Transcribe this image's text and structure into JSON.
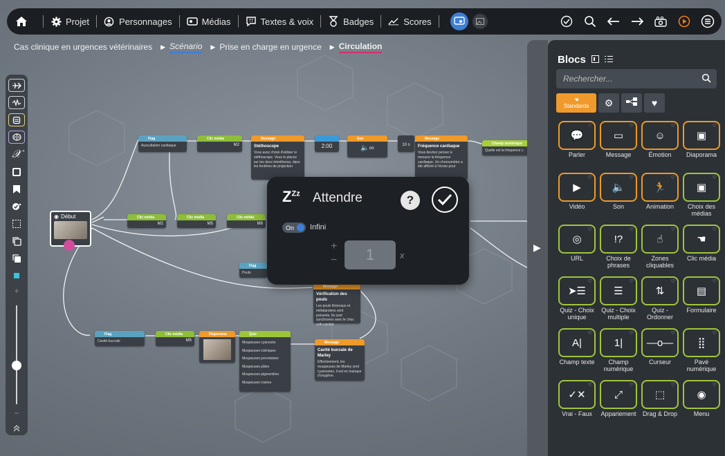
{
  "topbar": {
    "items": [
      {
        "label": "Projet",
        "icon": "gear-icon"
      },
      {
        "label": "Personnages",
        "icon": "character-icon"
      },
      {
        "label": "Médias",
        "icon": "media-icon"
      },
      {
        "label": "Textes & voix",
        "icon": "text-voice-icon"
      },
      {
        "label": "Badges",
        "icon": "badge-icon"
      },
      {
        "label": "Scores",
        "icon": "scores-icon"
      }
    ]
  },
  "breadcrumb": {
    "project": "Cas clinique en urgences vétérinaires",
    "scenario": "Scénario",
    "module": "Prise en charge en urgence",
    "current": "Circulation"
  },
  "nodes": {
    "flag1": {
      "type": "Flag",
      "text": "Auscultation cardiaque"
    },
    "clic1": {
      "type": "Clic média",
      "value": "M2"
    },
    "msg1": {
      "type": "Message",
      "title": "Stéthoscope",
      "text": "Vous avez choisi d'utiliser le stéthoscope. Vous le placez sur les deux hémithorax, dans les fenêtres de projection"
    },
    "timer1": {
      "value": "2:00"
    },
    "son1": {
      "type": "Son"
    },
    "timer2": {
      "value": "10 s"
    },
    "msg2": {
      "type": "Message",
      "title": "Fréquence cardiaque",
      "text": "Vous devriez penser à mesurer la fréquence cardiaque. Un chronomètre a été affiché à l'écran pour"
    },
    "champ1": {
      "type": "Champ numérique",
      "text": "Quelle est la fréquence c."
    },
    "debut": {
      "label": "Début"
    },
    "clic2": {
      "type": "Clic média",
      "value": "M2"
    },
    "clic3": {
      "type": "Clic média",
      "value": "M5"
    },
    "clic4": {
      "type": "Clic média",
      "value": "M6"
    },
    "flag2": {
      "type": "Flag",
      "text": "Pouls"
    },
    "msg3": {
      "type": "Message",
      "title": "Vérification des pouls",
      "text": "Les pouls fémoraux et métatarsiens sont présents. Ils sont synchrones avec le choc orth-cardial."
    },
    "flag3": {
      "type": "Flag",
      "text": "Cavité buccale"
    },
    "clic5": {
      "type": "Clic média",
      "value": "M5"
    },
    "diapo": {
      "type": "Diaporama"
    },
    "quiz": {
      "type": "Quiz",
      "options": [
        "Muqueuses cyanosés",
        "Muqueuses ictériques",
        "Muqueuses porcelaines",
        "Muqueuses pâles",
        "Muqueuses pigmentées",
        "Muqueuses rosées"
      ]
    },
    "msg4": {
      "type": "Message",
      "title": "Cavité buccale de Marley",
      "text": "Effectivement, les muqueuses de Marley sont cyanosées, il est en manque d'oxygène."
    }
  },
  "modal": {
    "title": "Attendre",
    "toggle_state": "On",
    "toggle_label": "Infini",
    "value": "1",
    "multiplier": "x"
  },
  "panel": {
    "title": "Blocs",
    "search_placeholder": "Rechercher...",
    "active_tab": "Standards",
    "blocks": [
      {
        "label": "Parler",
        "icon": "speech-bubble-icon",
        "color": "orange",
        "fav": true
      },
      {
        "label": "Message",
        "icon": "message-icon",
        "color": "orange"
      },
      {
        "label": "Émotion",
        "icon": "emotion-icon",
        "color": "orange"
      },
      {
        "label": "Diaporama",
        "icon": "slideshow-icon",
        "color": "orange"
      },
      {
        "label": "Vidéo",
        "icon": "video-icon",
        "color": "orange"
      },
      {
        "label": "Son",
        "icon": "sound-icon",
        "color": "orange"
      },
      {
        "label": "Animation",
        "icon": "animation-icon",
        "color": "orange"
      },
      {
        "label": "Choix des médias",
        "icon": "media-choice-icon",
        "color": "green"
      },
      {
        "label": "URL",
        "icon": "url-icon",
        "color": "green"
      },
      {
        "label": "Choix de phrases",
        "icon": "sentence-choice-icon",
        "color": "green"
      },
      {
        "label": "Zones cliquables",
        "icon": "click-zone-icon",
        "color": "green"
      },
      {
        "label": "Clic média",
        "icon": "click-media-icon",
        "color": "green"
      },
      {
        "label": "Quiz - Choix unique",
        "icon": "quiz-single-icon",
        "color": "green"
      },
      {
        "label": "Quiz - Choix multiple",
        "icon": "quiz-multiple-icon",
        "color": "green"
      },
      {
        "label": "Quiz - Ordonner",
        "icon": "quiz-order-icon",
        "color": "green"
      },
      {
        "label": "Formulaire",
        "icon": "form-icon",
        "color": "green"
      },
      {
        "label": "Champ texte",
        "icon": "text-field-icon",
        "color": "green"
      },
      {
        "label": "Champ numérique",
        "icon": "number-field-icon",
        "color": "green"
      },
      {
        "label": "Curseur",
        "icon": "slider-icon",
        "color": "green"
      },
      {
        "label": "Pavé numérique",
        "icon": "keypad-icon",
        "color": "green"
      },
      {
        "label": "Vrai - Faux",
        "icon": "true-false-icon",
        "color": "green"
      },
      {
        "label": "Appariement",
        "icon": "matching-icon",
        "color": "green"
      },
      {
        "label": "Drag & Drop",
        "icon": "drag-drop-icon",
        "color": "green"
      },
      {
        "label": "Menu",
        "icon": "menu-lifebuoy-icon",
        "color": "green"
      }
    ]
  },
  "colors": {
    "orange": "#ef9a2a",
    "green": "#a0c63a",
    "blue": "#3d7fd6",
    "pink": "#d0306a",
    "flag": "#5aa3c0"
  }
}
